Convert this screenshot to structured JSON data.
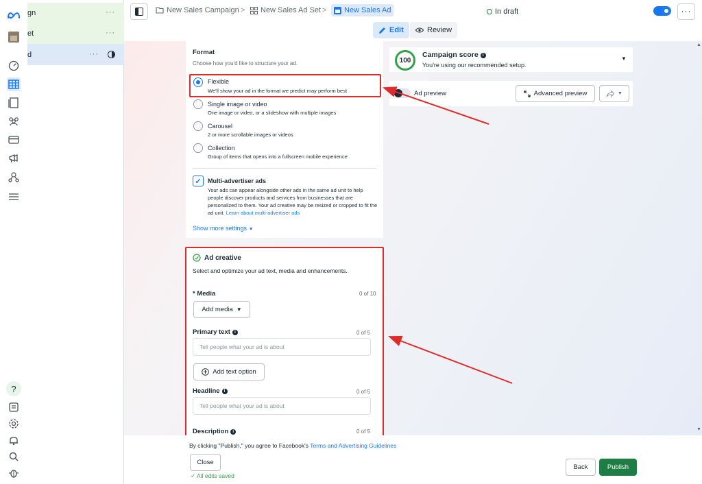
{
  "colors": {
    "accent": "#1877f2",
    "publish": "#1e7d45",
    "annotation": "#e02b2b",
    "score": "#31a24c"
  },
  "rail": {
    "icons": [
      "meta-logo-icon",
      "account-avatar-icon",
      "dashboard-gauge-icon",
      "ads-manager-table-icon",
      "pages-icon",
      "audiences-icon",
      "billing-card-icon",
      "campaigns-megaphone-icon",
      "business-settings-icon",
      "all-tools-menu-icon",
      "help-icon",
      "reports-icon",
      "settings-gear-icon",
      "notifications-bell-icon",
      "search-icon",
      "bug-report-icon"
    ]
  },
  "tree": {
    "campaign_label": "gn",
    "adset_label": "et",
    "ad_label": "d",
    "more": "···"
  },
  "breadcrumb": {
    "campaign": "New Sales Campaign",
    "adset": "New Sales Ad Set",
    "ad": "New Sales Ad",
    "separator": ">"
  },
  "header": {
    "status": "In draft",
    "more": "···"
  },
  "modes": {
    "edit": "Edit",
    "review": "Review"
  },
  "format": {
    "title": "Format",
    "subtitle": "Choose how you'd like to structure your ad.",
    "options": [
      {
        "title": "Flexible",
        "desc": "We'll show your ad in the format we predict may perform best"
      },
      {
        "title": "Single image or video",
        "desc": "One image or video, or a slideshow with multiple images"
      },
      {
        "title": "Carousel",
        "desc": "2 or more scrollable images or videos"
      },
      {
        "title": "Collection",
        "desc": "Group of items that opens into a fullscreen mobile experience"
      }
    ],
    "multi_title": "Multi-advertiser ads",
    "multi_desc": "Your ads can appear alongside other ads in the same ad unit to help people discover products and services from businesses that are personalized to them. Your ad creative may be resized or cropped to fit the ad unit.",
    "multi_link": "Learn about multi-advertiser ads",
    "show_more": "Show more settings"
  },
  "creative": {
    "title": "Ad creative",
    "subtitle": "Select and optimize your ad text, media and enhancements.",
    "media_label": "* Media",
    "media_count": "0 of 10",
    "add_media": "Add media",
    "primary_label": "Primary text",
    "primary_count": "0 of 5",
    "primary_placeholder": "Tell people what your ad is about",
    "add_text": "Add text option",
    "headline_label": "Headline",
    "headline_count": "0 of 5",
    "headline_placeholder": "Tell people what your ad is about",
    "description_label": "Description",
    "description_count": "0 of 5"
  },
  "score": {
    "value": "100",
    "title": "Campaign score",
    "subtitle": "You're using our recommended setup."
  },
  "preview": {
    "label": "Ad preview",
    "advanced": "Advanced preview"
  },
  "footer": {
    "terms_prefix": "By clicking \"Publish,\" you agree to Facebook's",
    "terms_link": "Terms and Advertising Guidelines",
    "close": "Close",
    "saved": "All edits saved",
    "back": "Back",
    "publish": "Publish"
  }
}
